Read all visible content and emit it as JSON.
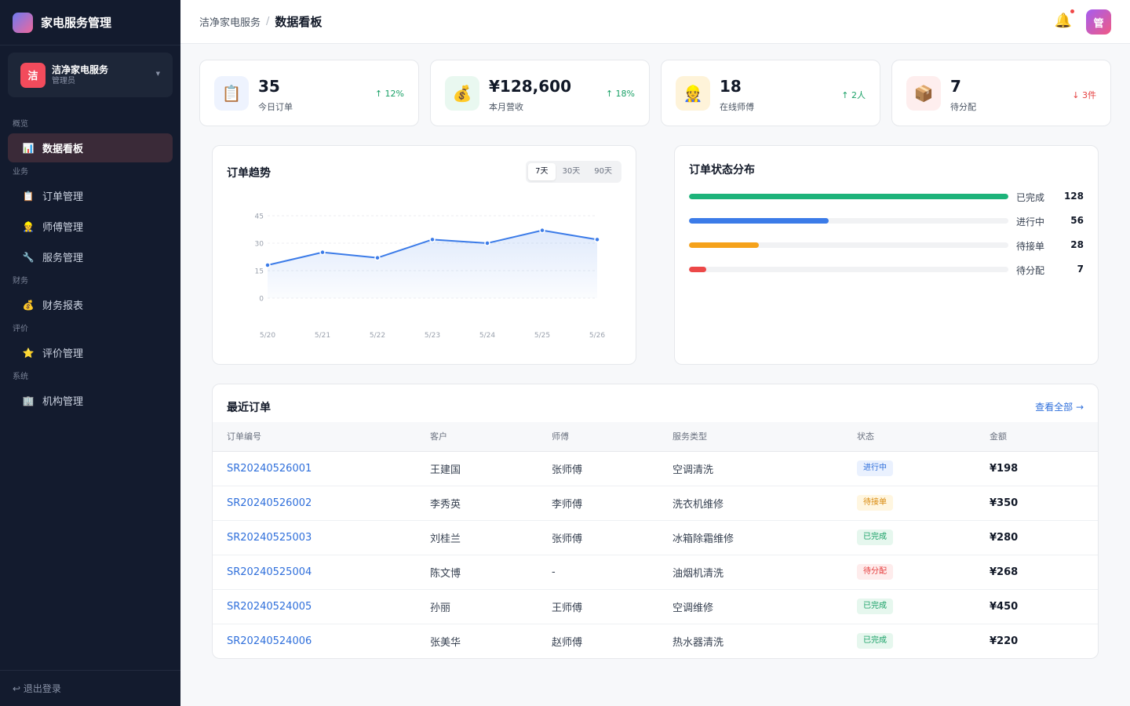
{
  "app": {
    "title": "家电服务管理"
  },
  "org": {
    "avatar": "洁",
    "name": "洁净家电服务",
    "role": "管理员"
  },
  "nav": [
    {
      "section": "概览",
      "items": [
        {
          "label": "数据看板",
          "icon": "bar-chart-icon",
          "glyph": "📊",
          "active": true
        }
      ]
    },
    {
      "section": "业务",
      "items": [
        {
          "label": "订单管理",
          "icon": "clipboard-icon",
          "glyph": "📋",
          "active": false
        },
        {
          "label": "师傅管理",
          "icon": "worker-icon",
          "glyph": "👷",
          "active": false
        },
        {
          "label": "服务管理",
          "icon": "wrench-icon",
          "glyph": "🔧",
          "active": false
        }
      ]
    },
    {
      "section": "财务",
      "items": [
        {
          "label": "财务报表",
          "icon": "money-bag-icon",
          "glyph": "💰",
          "active": false
        }
      ]
    },
    {
      "section": "评价",
      "items": [
        {
          "label": "评价管理",
          "icon": "star-icon",
          "glyph": "⭐",
          "active": false
        }
      ]
    },
    {
      "section": "系统",
      "items": [
        {
          "label": "机构管理",
          "icon": "building-icon",
          "glyph": "🏢",
          "active": false
        }
      ]
    }
  ],
  "logout": "↩ 退出登录",
  "header": {
    "breadcrumb_parent": "洁净家电服务",
    "breadcrumb_sep": "/",
    "breadcrumb_current": "数据看板",
    "user_avatar": "管"
  },
  "stats": [
    {
      "value": "35",
      "label": "今日订单",
      "trend": "↑ 12%",
      "direction": "up",
      "icon": "clipboard-icon",
      "glyph": "📋",
      "bg": "#eef3fe"
    },
    {
      "value": "¥128,600",
      "label": "本月营收",
      "trend": "↑ 18%",
      "direction": "up",
      "icon": "money-bag-icon",
      "glyph": "💰",
      "bg": "#e9f8f0"
    },
    {
      "value": "18",
      "label": "在线师傅",
      "trend": "↑ 2人",
      "direction": "up",
      "icon": "worker-icon",
      "glyph": "👷",
      "bg": "#fef3d9"
    },
    {
      "value": "7",
      "label": "待分配",
      "trend": "↓ 3件",
      "direction": "down",
      "icon": "package-icon",
      "glyph": "📦",
      "bg": "#feeeee"
    }
  ],
  "trend_panel": {
    "title": "订单趋势",
    "ranges": [
      "7天",
      "30天",
      "90天"
    ],
    "active_range": 0
  },
  "chart_data": {
    "type": "area",
    "categories": [
      "5/20",
      "5/21",
      "5/22",
      "5/23",
      "5/24",
      "5/25",
      "5/26"
    ],
    "values": [
      18,
      25,
      22,
      32,
      30,
      37,
      32
    ],
    "yticks": [
      0,
      15,
      30,
      45
    ],
    "ylim": [
      0,
      45
    ],
    "grid": true,
    "color": "#3b7be8"
  },
  "status_panel": {
    "title": "订单状态分布",
    "items": [
      {
        "name": "已完成",
        "count": 128,
        "color": "#1db37a"
      },
      {
        "name": "进行中",
        "count": 56,
        "color": "#3b7be8"
      },
      {
        "name": "待接单",
        "count": 28,
        "color": "#f5a21b"
      },
      {
        "name": "待分配",
        "count": 7,
        "color": "#ec4848"
      }
    ]
  },
  "orders": {
    "title": "最近订单",
    "view_all": "查看全部 →",
    "columns": [
      "订单编号",
      "客户",
      "师傅",
      "服务类型",
      "状态",
      "金额"
    ],
    "rows": [
      {
        "id": "SR20240526001",
        "customer": "王建国",
        "worker": "张师傅",
        "service": "空调清洗",
        "status": "进行中",
        "status_type": "progress",
        "amount": "¥198"
      },
      {
        "id": "SR20240526002",
        "customer": "李秀英",
        "worker": "李师傅",
        "service": "洗衣机维修",
        "status": "待接单",
        "status_type": "waiting",
        "amount": "¥350"
      },
      {
        "id": "SR20240525003",
        "customer": "刘桂兰",
        "worker": "张师傅",
        "service": "冰箱除霜维修",
        "status": "已完成",
        "status_type": "done",
        "amount": "¥280"
      },
      {
        "id": "SR20240525004",
        "customer": "陈文博",
        "worker": "-",
        "service": "油烟机清洗",
        "status": "待分配",
        "status_type": "assign",
        "amount": "¥268"
      },
      {
        "id": "SR20240524005",
        "customer": "孙丽",
        "worker": "王师傅",
        "service": "空调维修",
        "status": "已完成",
        "status_type": "done",
        "amount": "¥450"
      },
      {
        "id": "SR20240524006",
        "customer": "张美华",
        "worker": "赵师傅",
        "service": "热水器清洗",
        "status": "已完成",
        "status_type": "done",
        "amount": "¥220"
      }
    ]
  }
}
